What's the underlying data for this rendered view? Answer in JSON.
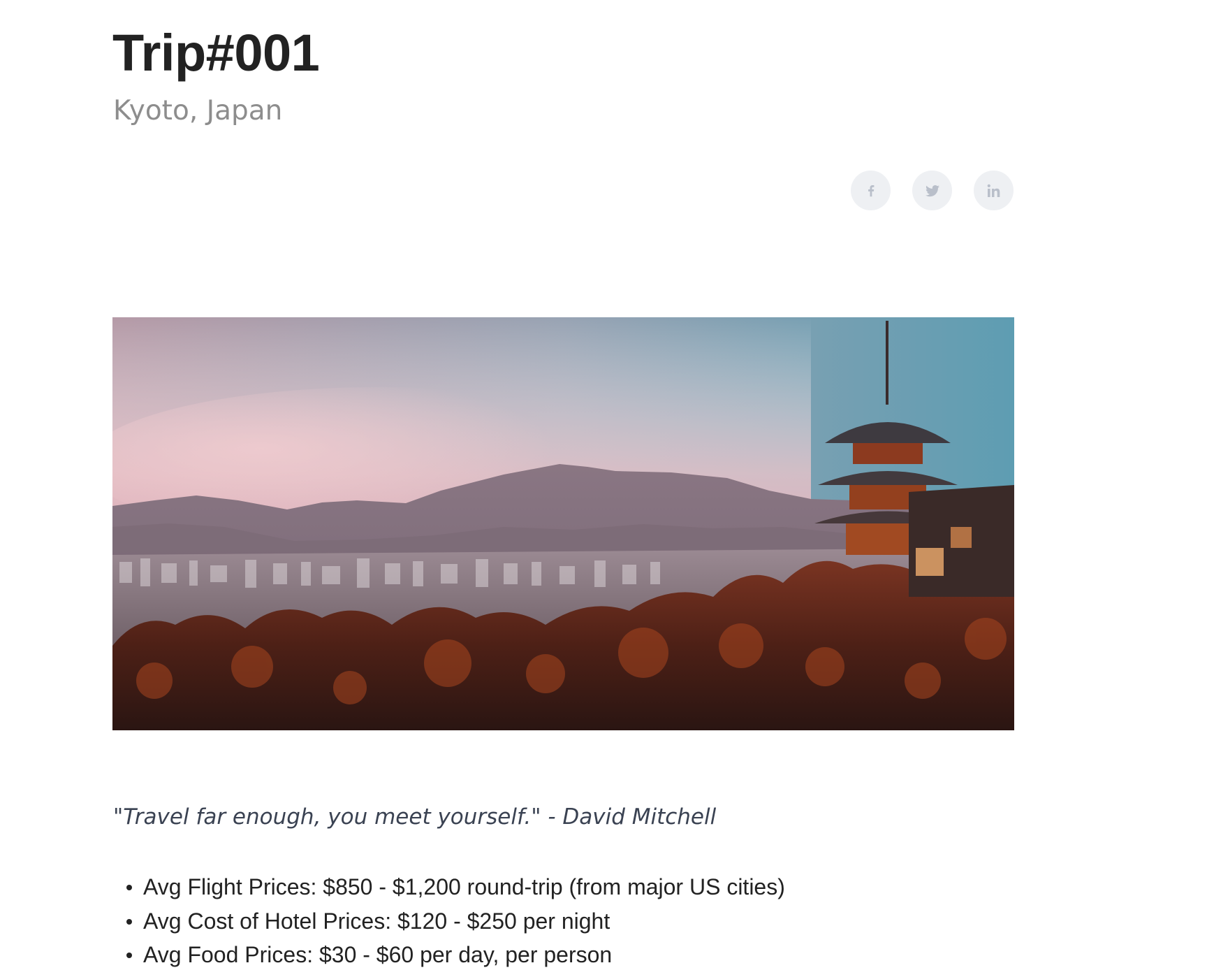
{
  "header": {
    "title": "Trip#001",
    "subtitle": "Kyoto, Japan"
  },
  "share": {
    "items": [
      {
        "icon": "facebook-icon",
        "glyph": "f"
      },
      {
        "icon": "twitter-icon",
        "glyph": "twitter-bird"
      },
      {
        "icon": "linkedin-icon",
        "glyph": "in"
      }
    ],
    "icon_color": "#b9bfca",
    "button_color": "#eef0f3"
  },
  "hero": {
    "description_icon": "landscape-photo",
    "colors": {
      "sky_top_left": "#a79aa9",
      "sky_top_right": "#5f9fb3",
      "sky_horizon": "#e9bfc6",
      "mountains": "#7d6d79",
      "foliage": "#5a2418",
      "pagoda": "#8a3a1e"
    }
  },
  "quote": {
    "text": "\"Travel far enough, you meet yourself.\" - David Mitchell"
  },
  "facts": [
    "Avg Flight Prices: $850 - $1,200 round-trip (from major US cities)",
    "Avg Cost of Hotel Prices: $120 - $250 per night",
    "Avg Food Prices: $30 - $60 per day, per person"
  ]
}
